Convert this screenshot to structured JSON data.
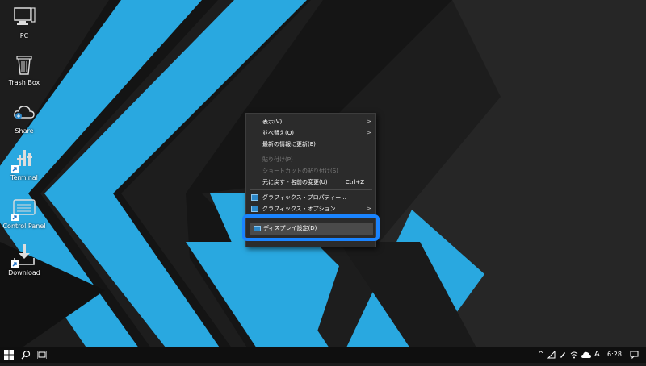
{
  "desktop": {
    "icons": [
      {
        "label": "PC",
        "icon": "pc-icon"
      },
      {
        "label": "Trash Box",
        "icon": "trash-icon"
      },
      {
        "label": "Share",
        "icon": "cloud-share-icon"
      },
      {
        "label": "Terminal",
        "icon": "terminal-icon"
      },
      {
        "label": "Control Panel",
        "icon": "control-panel-icon"
      },
      {
        "label": "Download",
        "icon": "download-icon"
      }
    ]
  },
  "context_menu": {
    "items": [
      {
        "label": "表示(V)",
        "submenu": true
      },
      {
        "label": "並べ替え(O)",
        "submenu": true
      },
      {
        "label": "最新の情報に更新(E)"
      },
      {
        "label": "貼り付け(P)",
        "disabled": true
      },
      {
        "label": "ショートカットの貼り付け(S)",
        "disabled": true
      },
      {
        "label": "元に戻す - 名前の変更(U)",
        "shortcut": "Ctrl+Z"
      },
      {
        "label": "グラフィックス・プロパティー...",
        "icon": "graphics-icon"
      },
      {
        "label": "グラフィックス・オプション",
        "submenu": true,
        "icon": "graphics-icon"
      },
      {
        "label": "ディスプレイ設定(D)",
        "icon": "display-settings-icon",
        "highlighted": true
      }
    ],
    "submenu_arrow": ">"
  },
  "taskbar": {
    "clock": "6:28",
    "ime": "A",
    "chevron": "^",
    "start_icon": "windows-start-icon",
    "search_icon": "search-icon",
    "taskview_icon": "task-view-icon"
  },
  "colors": {
    "accent_blue": "#29a8e0",
    "highlight_border": "#1a84ff",
    "menu_bg": "#2b2b2b"
  }
}
